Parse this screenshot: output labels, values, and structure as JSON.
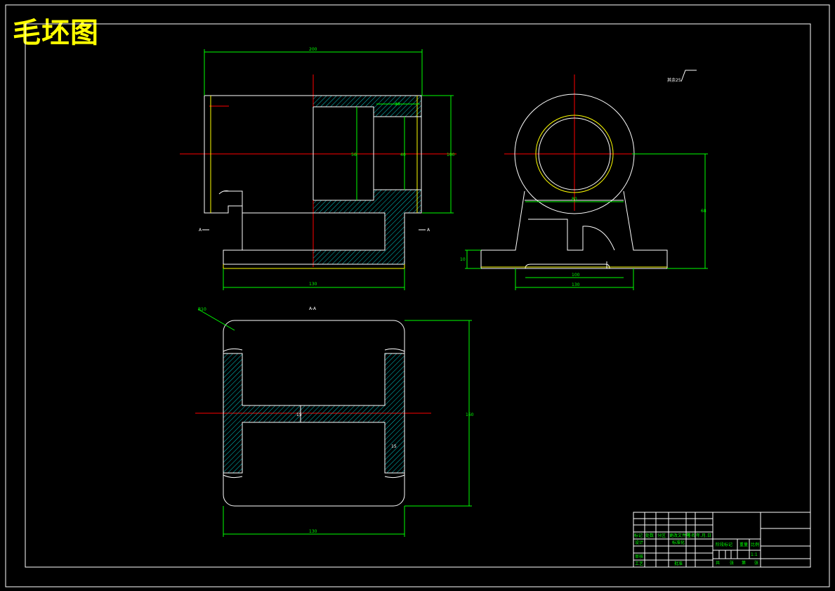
{
  "title": "毛坯图",
  "colors": {
    "background": "#000000",
    "outline": "#ffffff",
    "centerline": "#ff0000",
    "dimension": "#00ff00",
    "hatch": "#00ffff",
    "title": "#ffff00",
    "allowance": "#ffff00"
  },
  "views": {
    "front": {
      "dim_overall_width": "200",
      "dim_height": "100",
      "dim_bore": "56",
      "dim_inner": "40",
      "dim_small": "30",
      "dim_base": "130",
      "section_mark_left": "A",
      "section_mark_right": "A"
    },
    "side": {
      "roughness_note": "其余",
      "roughness_value": "25",
      "dim_center_height": "68",
      "dim_base_height": "10",
      "dim_width_upper": "80",
      "dim_width_mid": "100",
      "dim_width_bottom": "130"
    },
    "section": {
      "label": "A-A",
      "dim_radius": "R10",
      "dim_height": "160",
      "dim_width": "130",
      "dim_web": "15",
      "dim_rib": "15"
    }
  },
  "title_block": {
    "row1": [
      "标记",
      "处数",
      "分区",
      "更改文件号",
      "签名",
      "年.月.日"
    ],
    "design": "设计",
    "standard": "标准化",
    "review": "审核",
    "process": "工艺",
    "approve": "批准",
    "stage": "阶段标记",
    "weight": "重量",
    "ratio": "比例",
    "scale_value": "1:1",
    "sheets": [
      "共",
      "张",
      "第",
      "张"
    ]
  }
}
